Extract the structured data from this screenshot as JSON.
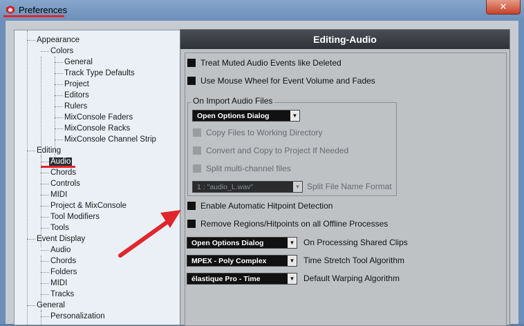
{
  "window": {
    "title": "Preferences",
    "close_glyph": "✕",
    "accent_red": "#e0262a"
  },
  "tree": {
    "items": [
      {
        "label": "Appearance",
        "level": 0
      },
      {
        "label": "Colors",
        "level": 1
      },
      {
        "label": "General",
        "level": 2
      },
      {
        "label": "Track Type Defaults",
        "level": 2
      },
      {
        "label": "Project",
        "level": 2
      },
      {
        "label": "Editors",
        "level": 2
      },
      {
        "label": "Rulers",
        "level": 2
      },
      {
        "label": "MixConsole Faders",
        "level": 2
      },
      {
        "label": "MixConsole Racks",
        "level": 2
      },
      {
        "label": "MixConsole Channel Strip",
        "level": 2
      },
      {
        "label": "Editing",
        "level": 0
      },
      {
        "label": "Audio",
        "level": 1,
        "selected": true
      },
      {
        "label": "Chords",
        "level": 1
      },
      {
        "label": "Controls",
        "level": 1
      },
      {
        "label": "MIDI",
        "level": 1
      },
      {
        "label": "Project & MixConsole",
        "level": 1
      },
      {
        "label": "Tool Modifiers",
        "level": 1
      },
      {
        "label": "Tools",
        "level": 1
      },
      {
        "label": "Event Display",
        "level": 0
      },
      {
        "label": "Audio",
        "level": 1
      },
      {
        "label": "Chords",
        "level": 1
      },
      {
        "label": "Folders",
        "level": 1
      },
      {
        "label": "MIDI",
        "level": 1
      },
      {
        "label": "Tracks",
        "level": 1
      },
      {
        "label": "General",
        "level": 0
      },
      {
        "label": "Personalization",
        "level": 1
      }
    ]
  },
  "panel": {
    "title": "Editing-Audio",
    "options": {
      "treat_muted": "Treat Muted Audio Events like Deleted",
      "mouse_wheel": "Use Mouse Wheel for Event Volume and Fades",
      "enable_hitpoint": "Enable Automatic Hitpoint Detection",
      "remove_regions": "Remove Regions/Hitpoints on all Offline Processes"
    },
    "import_group": {
      "title": "On Import Audio Files",
      "dropdown_value": "Open Options Dialog",
      "copy_files": "Copy Files to Working Directory",
      "convert_copy": "Convert and Copy to Project If Needed",
      "split_multichannel": "Split multi-channel files",
      "split_format_value": "1 : \"audio_L.wav\"",
      "split_format_label": "Split File Name Format"
    },
    "processing_shared": {
      "value": "Open Options Dialog",
      "label": "On Processing Shared Clips"
    },
    "time_stretch": {
      "value": "MPEX - Poly Complex",
      "label": "Time Stretch Tool Algorithm"
    },
    "warping": {
      "value": "élastique Pro - Time",
      "label": "Default Warping Algorithm"
    }
  },
  "icons": {
    "dropdown_arrow": "▼",
    "app_icon": "cubase-logo-icon"
  }
}
